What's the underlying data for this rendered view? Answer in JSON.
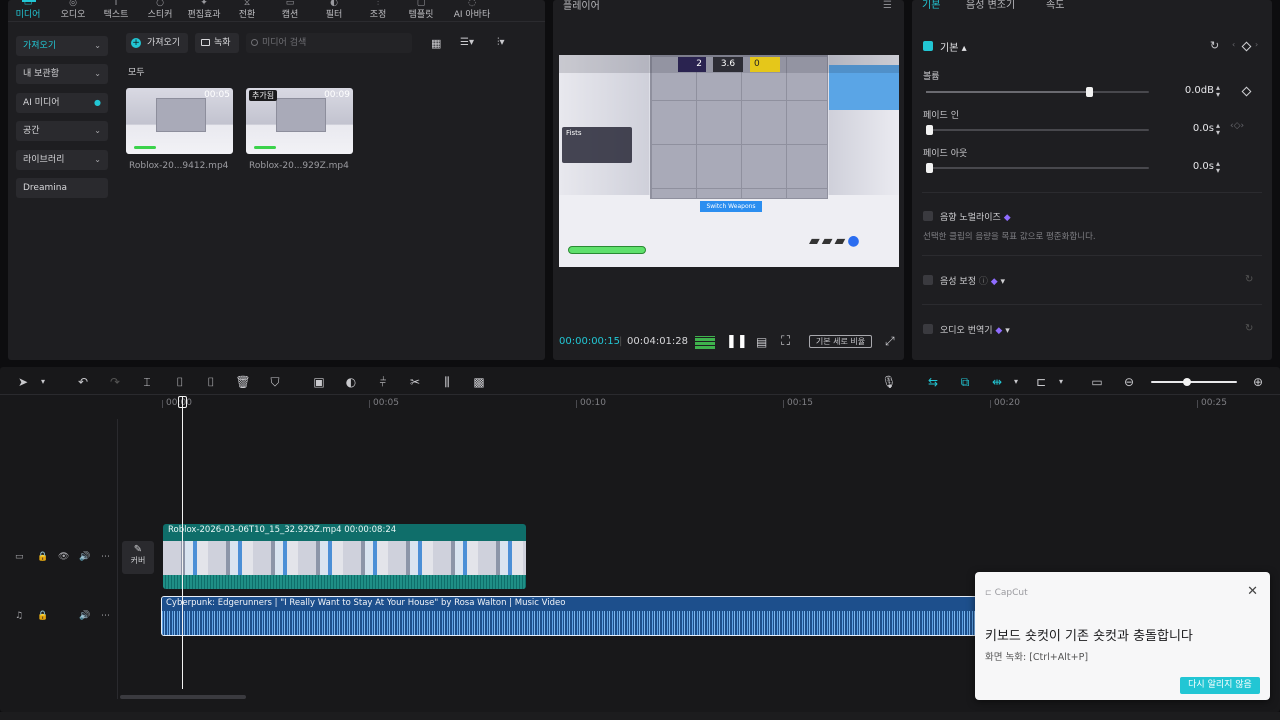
{
  "nav": {
    "tabs": [
      {
        "label": "미디어",
        "icon": "media-icon"
      },
      {
        "label": "오디오",
        "icon": "audio-icon"
      },
      {
        "label": "텍스트",
        "icon": "text-icon"
      },
      {
        "label": "스티커",
        "icon": "sticker-icon"
      },
      {
        "label": "편집효과",
        "icon": "effects-icon"
      },
      {
        "label": "전환",
        "icon": "transition-icon"
      },
      {
        "label": "캡션",
        "icon": "caption-icon"
      },
      {
        "label": "필터",
        "icon": "filter-icon"
      },
      {
        "label": "조정",
        "icon": "adjust-icon"
      },
      {
        "label": "템플릿",
        "icon": "template-icon"
      },
      {
        "label": "AI 아바타",
        "icon": "ai-avatar-icon"
      }
    ]
  },
  "media": {
    "sidebar": [
      "가져오기",
      "내 보관함",
      "AI 미디어",
      "공간",
      "라이브러리",
      "Dreamina"
    ],
    "import_label": "가져오기",
    "record_label": "녹화",
    "search_placeholder": "미디어 검색",
    "section_label": "모두",
    "items": [
      {
        "name": "Roblox-20...9412.mp4",
        "duration": "00:05",
        "tag": ""
      },
      {
        "name": "Roblox-20...929Z.mp4",
        "duration": "00:09",
        "tag": "추가됨"
      }
    ]
  },
  "player": {
    "title": "플레이어",
    "current_time": "00:00:00:15",
    "total_time": "00:04:01:28",
    "ratio_label": "기본 세로 비율",
    "game": {
      "score_left": "2",
      "timer": "3.6",
      "score_right": "0",
      "button": "Switch Weapons",
      "player_name": "Fists"
    }
  },
  "props": {
    "tabs": [
      "기본",
      "음성 변조기",
      "속도"
    ],
    "section": "기본",
    "volume_label": "볼륨",
    "volume_value": "0.0dB",
    "volume_level": 0.73,
    "fadein_label": "페이드 인",
    "fadein_value": "0.0s",
    "fadeout_label": "페이드 아웃",
    "fadeout_value": "0.0s",
    "normalize_label": "음향 노멀라이즈",
    "normalize_desc": "선택한 클립의 음량을 목표 값으로 평준화합니다.",
    "enhance_label": "음성 보정",
    "translate_label": "오디오 번역기"
  },
  "timeline": {
    "ruler": [
      "00:00",
      "00:05",
      "00:10",
      "00:15",
      "00:20",
      "00:25"
    ],
    "cover_label": "커버",
    "video_clip": "Roblox-2026-03-06T10_15_32.929Z.mp4   00:00:08:24",
    "audio_clip": "Cyberpunk: Edgerunners | \"I Really Want to Stay At Your House\" by Rosa Walton | Music Video",
    "zoom_level": 0.42
  },
  "toast": {
    "brand": "CapCut",
    "title": "키보드 숏컷이 기존 숏컷과 충돌합니다",
    "desc": "화면 녹화: [Ctrl+Alt+P]",
    "button": "다시 알리지 않음"
  },
  "colors": {
    "accent": "#22c6d4",
    "audio": "#1d4f8c",
    "video": "#0f6e6a"
  }
}
